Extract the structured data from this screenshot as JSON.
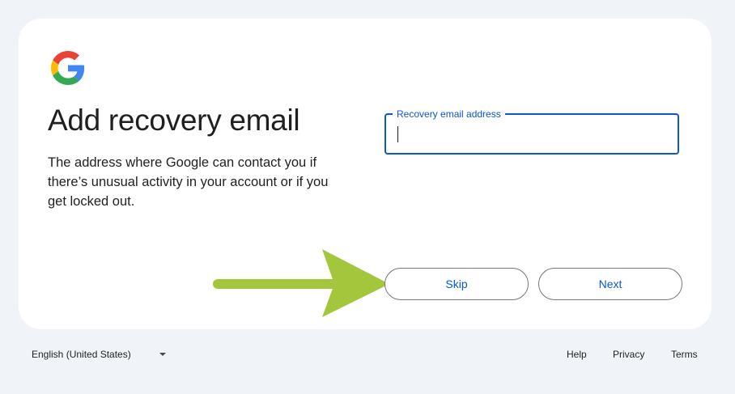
{
  "card": {
    "title": "Add recovery email",
    "description": "The address where Google can contact you if there’s unusual activity in your account or if you get locked out."
  },
  "field": {
    "label": "Recovery email address",
    "value": ""
  },
  "buttons": {
    "skip_label": "Skip",
    "next_label": "Next"
  },
  "annotation": {
    "arrow_color": "#a4c63d"
  },
  "footer": {
    "language": "English (United States)",
    "links": [
      "Help",
      "Privacy",
      "Terms"
    ]
  },
  "colors": {
    "accent": "#0b57d0",
    "background": "#f0f4f9"
  },
  "icons": [
    "google-logo-icon",
    "chevron-down-icon",
    "arrow-annotation-icon"
  ]
}
